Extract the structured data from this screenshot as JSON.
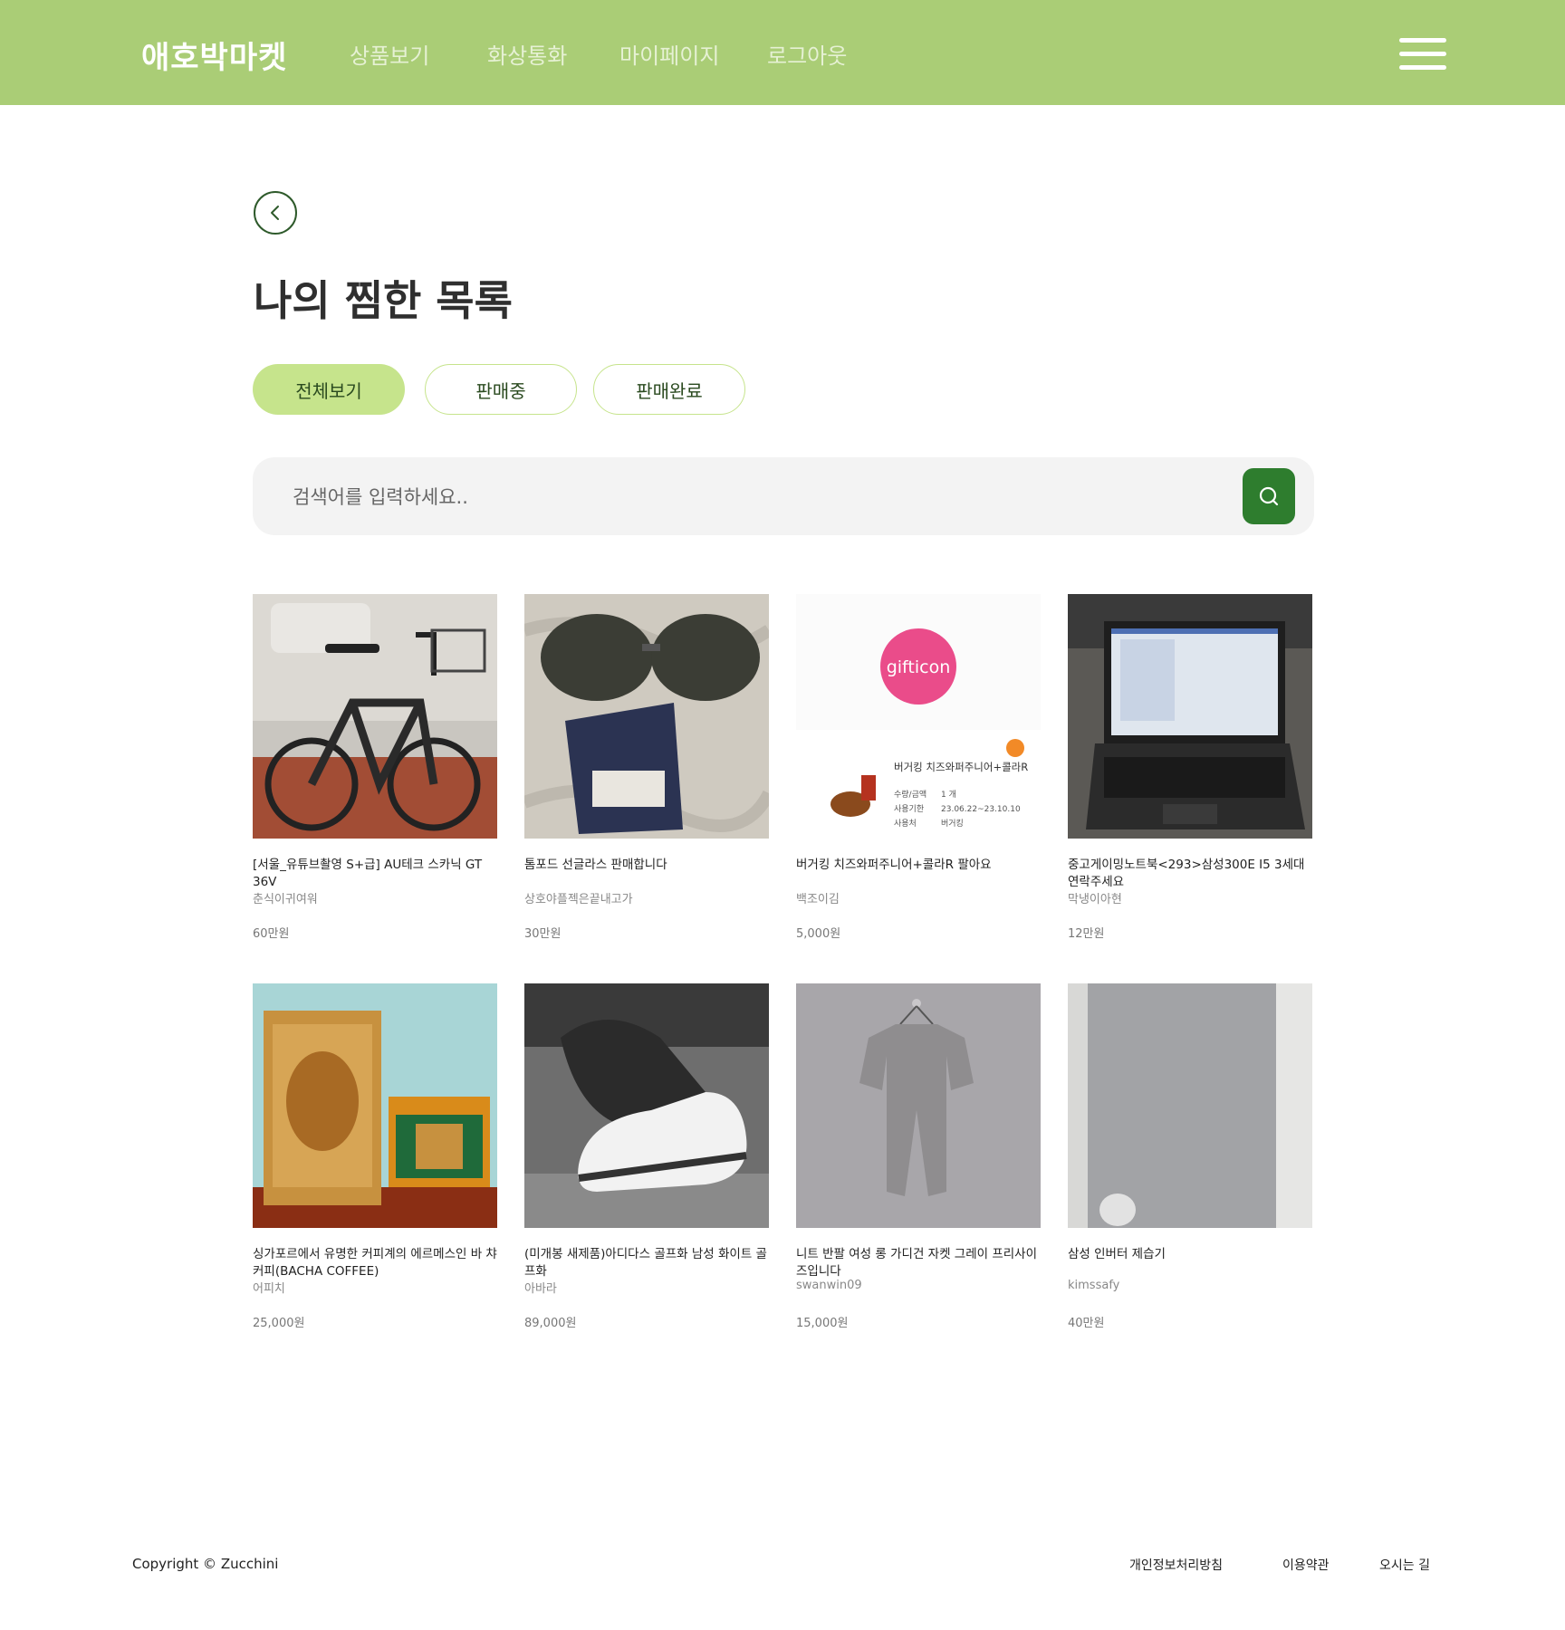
{
  "header": {
    "brand": "애호박마켓",
    "nav": [
      "상품보기",
      "화상통화",
      "마이페이지",
      "로그아웃"
    ],
    "bg_color": "#aacd76"
  },
  "page": {
    "title": "나의 찜한 목록",
    "filters": [
      {
        "label": "전체보기",
        "active": true
      },
      {
        "label": "판매중",
        "active": false
      },
      {
        "label": "판매완료",
        "active": false
      }
    ]
  },
  "search": {
    "placeholder": "검색어를 입력하세요..",
    "button_color": "#2e7d2e"
  },
  "products": [
    {
      "name": "[서울_유튜브촬영 S+급] AU테크 스카닉 GT 36V",
      "seller": "춘식이귀여워",
      "price": "60만원",
      "image": "electric-bicycle"
    },
    {
      "name": "톰포드 선글라스 판매합니다",
      "seller": "상호야플젝은끝내고가",
      "price": "30만원",
      "image": "sunglasses"
    },
    {
      "name": "버거킹 치즈와퍼주니어+콜라R 팔아요",
      "seller": "백조이김",
      "price": "5,000원",
      "image": "gifticon-voucher",
      "image_text": {
        "logo": "gifticon",
        "title": "버거킹 치즈와퍼주니어+콜라R",
        "qty_label": "수량/금액",
        "qty": "1 개",
        "period_label": "사용기한",
        "period": "23.06.22~23.10.10",
        "place_label": "사용처",
        "place": "버거킹"
      }
    },
    {
      "name": "중고게이밍노트북<293>삼성300E I5 3세대 연락주세요",
      "seller": "막냉이아현",
      "price": "12만원",
      "image": "laptop"
    },
    {
      "name": "싱가포르에서 유명한 커피계의 에르메스인 바 챠커피(BACHA COFFEE)",
      "seller": "어피치",
      "price": "25,000원",
      "image": "coffee-package"
    },
    {
      "name": "(미개봉 새제품)아디다스 골프화 남성 화이트 골프화",
      "seller": "아바라",
      "price": "89,000원",
      "image": "golf-shoe"
    },
    {
      "name": "니트 반팔 여성 롱 가디건 자켓 그레이 프리사이즈입니다",
      "seller": "swanwin09",
      "price": "15,000원",
      "image": "cardigan"
    },
    {
      "name": "삼성 인버터 제습기",
      "seller": "kimssafy",
      "price": "40만원",
      "image": "dehumidifier"
    }
  ],
  "footer": {
    "copyright": "Copyright © Zucchini",
    "links": [
      "개인정보처리방침",
      "이용약관",
      "오시는 길"
    ]
  }
}
